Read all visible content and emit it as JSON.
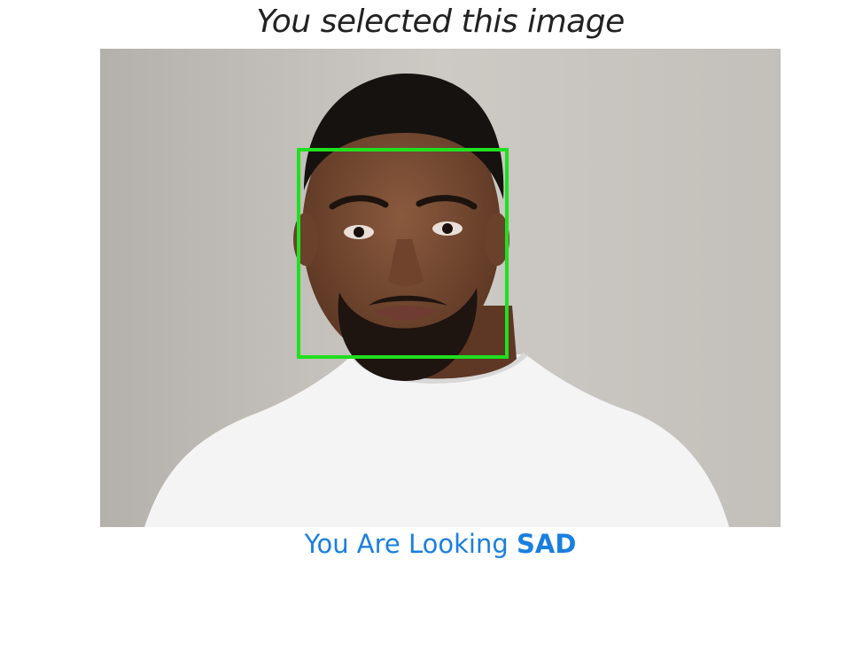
{
  "title": "You selected this image",
  "photo": {
    "icon": "portrait-photo",
    "face_box_color": "#1fe01f"
  },
  "result": {
    "prefix": "You Are Looking",
    "emotion": "SAD",
    "color": "#1a7fe0"
  }
}
